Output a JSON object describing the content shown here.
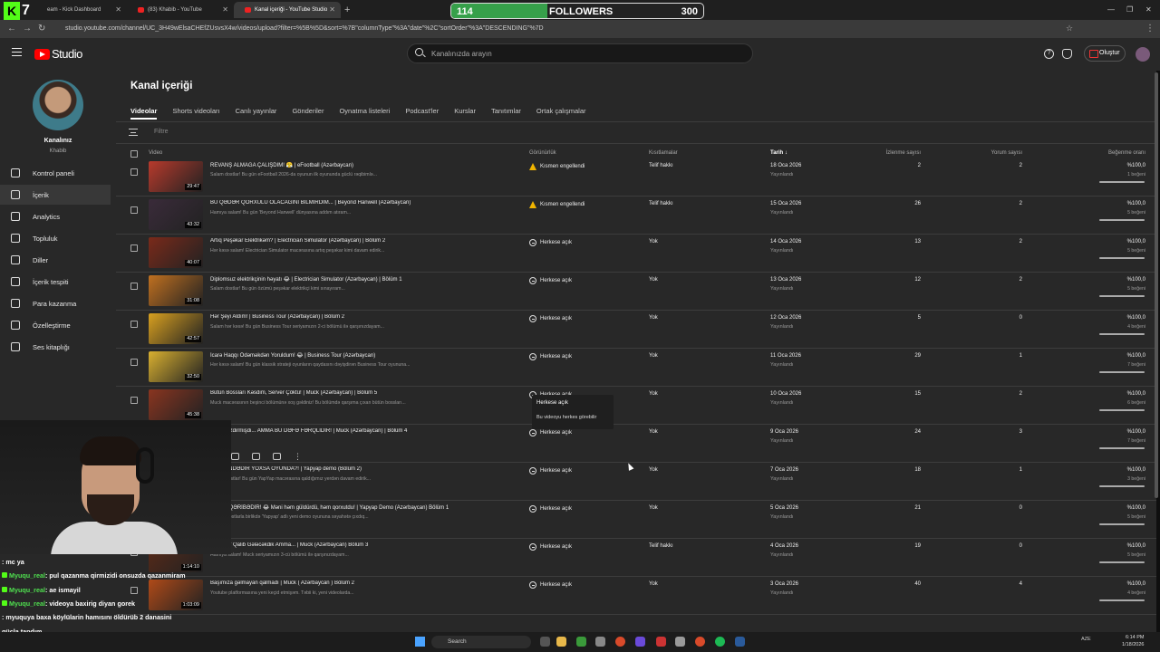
{
  "browser": {
    "tabs": [
      {
        "label": "eam - Kick Dashboard",
        "active": false
      },
      {
        "label": "(83) Khabib - YouTube",
        "active": false
      },
      {
        "label": "Kanal içeriği - YouTube Studio",
        "active": true
      }
    ],
    "url": "studio.youtube.com/channel/UC_3H49wElsaCHEfZUsvsX4w/videos/upload?filter=%5B%5D&sort=%7B\"columnType\"%3A\"date\"%2C\"sortOrder\"%3A\"DESCENDING\"%7D"
  },
  "overlay": {
    "kick_logo_number": "7",
    "followers_label": "FOLLOWERS",
    "followers_current": "114",
    "followers_goal": "300",
    "followers_progress": 0.38
  },
  "header": {
    "logo_text": "Studio",
    "search_placeholder": "Kanalınızda arayın",
    "create_label": "Oluştur"
  },
  "sidebar": {
    "channel_title": "Kanalınız",
    "channel_name": "Khabib",
    "items": [
      {
        "label": "Kontrol paneli",
        "icon": "dashboard-icon",
        "active": false
      },
      {
        "label": "İçerik",
        "icon": "content-icon",
        "active": true
      },
      {
        "label": "Analytics",
        "icon": "analytics-icon",
        "active": false
      },
      {
        "label": "Topluluk",
        "icon": "community-icon",
        "active": false
      },
      {
        "label": "Diller",
        "icon": "languages-icon",
        "active": false
      },
      {
        "label": "İçerik tespiti",
        "icon": "content-detection-icon",
        "active": false
      },
      {
        "label": "Para kazanma",
        "icon": "monetization-icon",
        "active": false
      },
      {
        "label": "Özelleştirme",
        "icon": "customization-icon",
        "active": false
      },
      {
        "label": "Ses kitaplığı",
        "icon": "audio-library-icon",
        "active": false
      }
    ]
  },
  "main": {
    "title": "Kanal içeriği",
    "tabs": [
      "Videolar",
      "Shorts videoları",
      "Canlı yayınlar",
      "Gönderiler",
      "Oynatma listeleri",
      "Podcast'ler",
      "Kurslar",
      "Tanıtımlar",
      "Ortak çalışmalar"
    ],
    "filter_placeholder": "Filtre",
    "columns": {
      "video": "Video",
      "visibility": "Görünürlük",
      "restrictions": "Kısıtlamalar",
      "date": "Tarih",
      "views": "İzlenme sayısı",
      "comments": "Yorum sayısı",
      "likes": "Beğenme oranı"
    },
    "tooltip": {
      "title": "Herkese açık",
      "desc": "Bu videoyu herkes görebilir"
    },
    "rows": [
      {
        "title": "REVANŞ ALMAĞA ÇALIŞDIM! 😤 | eFootball (Azərbaycan)",
        "desc": "Salam dostlar! Bu gün eFootball 2026-da oyunun ilk oyununda güclü rəqibimlə...",
        "duration": "29:47",
        "visibility": "Kısmen engellendi",
        "vis_icon": "warning-icon",
        "restriction": "Telif hakkı",
        "date": "18 Oca 2026",
        "status": "Yayınlandı",
        "views": "2",
        "comments": "2",
        "like_pct": "%100,0",
        "like_count": "1 beğeni",
        "thumb": "#b83a2c"
      },
      {
        "title": "BU QƏDƏR QORXULU OLACAĞINI BİLMİRDİM... | Beyond Hanwell (Azərbaycan)",
        "desc": "Hamıya salam! Bu gün 'Beyond Hanwell' dünyasına addım atıram...",
        "duration": "43:32",
        "visibility": "Kısmen engellendi",
        "vis_icon": "warning-icon",
        "restriction": "Telif hakkı",
        "date": "15 Oca 2026",
        "status": "Yayınlandı",
        "views": "26",
        "comments": "2",
        "like_pct": "%100,0",
        "like_count": "5 beğeni",
        "thumb": "#3a2b3a"
      },
      {
        "title": "Artıq Peşəkar Elektrikəm? | Electrician Simulator (Azərbaycan) | Bölüm 2",
        "desc": "Hər kəsə salam! Electrician Simulator macərasına artıq peşəkar kimi davam edirik...",
        "duration": "40:07",
        "visibility": "Herkese açık",
        "vis_icon": "globe-icon",
        "restriction": "Yok",
        "date": "14 Oca 2026",
        "status": "Yayınlandı",
        "views": "13",
        "comments": "2",
        "like_pct": "%100,0",
        "like_count": "5 beğeni",
        "thumb": "#7a2a1a"
      },
      {
        "title": "Diplomsuz elektrikçinin həyatı 😂 | Electrician Simulator (Azərbaycan) | Bölüm 1",
        "desc": "Salam dostlar! Bu gün özümü peşəkar elektrikçi kimi sınayıram...",
        "duration": "31:08",
        "visibility": "Herkese açık",
        "vis_icon": "globe-icon",
        "restriction": "Yok",
        "date": "13 Oca 2026",
        "status": "Yayınlandı",
        "views": "12",
        "comments": "2",
        "like_pct": "%100,0",
        "like_count": "5 beğeni",
        "thumb": "#c07020"
      },
      {
        "title": "Hər Şeyi Aldım! | Business Tour (Azərbaycan) | Bölüm 2",
        "desc": "Salam hər kəsə! Bu gün Business Tour seriyamızın 2-ci bölümü ilə qarşınızdayam...",
        "duration": "42:57",
        "visibility": "Herkese açık",
        "vis_icon": "globe-icon",
        "restriction": "Yok",
        "date": "12 Oca 2026",
        "status": "Yayınlandı",
        "views": "5",
        "comments": "0",
        "like_pct": "%100,0",
        "like_count": "4 beğeni",
        "thumb": "#d8a020"
      },
      {
        "title": "İcarə Haqqı Ödəməkdən Yoruldum! 😂 | Business Tour (Azərbaycan)",
        "desc": "Hər kəsə salam! Bu gün klassik strateji oyunların qaydasını dəyişdirən Business Tour oyununa...",
        "duration": "32:50",
        "visibility": "Herkese açık",
        "vis_icon": "globe-icon",
        "restriction": "Yok",
        "date": "11 Oca 2026",
        "status": "Yayınlandı",
        "views": "29",
        "comments": "1",
        "like_pct": "%100,0",
        "like_count": "7 beğeni",
        "thumb": "#d9b030"
      },
      {
        "title": "Bütün Bossları Kəsdim, Server Çöktü! | Muck (Azərbaycan) | Bölüm 5",
        "desc": "Muck macərasının beşinci bölümünə xoş gəldiniz! Bu bölümdə qarşıma çıxan bütün bossları...",
        "duration": "45:38",
        "visibility": "Herkese açık",
        "vis_icon": "globe-icon",
        "restriction": "Yok",
        "date": "10 Oca 2026",
        "status": "Yayınlandı",
        "views": "15",
        "comments": "2",
        "like_pct": "%100,0",
        "like_count": "6 beğeni",
        "thumb": "#8a3520"
      },
      {
        "title": "ulani Bezdirmişdi... AMMA BU DƏFƏ FƏRQLİDİR! | Muck (Azərbaycan) | Bölüm 4",
        "desc": "",
        "duration": "",
        "visibility": "Herkese açık",
        "vis_icon": "globe-icon",
        "restriction": "Yok",
        "date": "9 Oca 2026",
        "status": "Yayınlandı",
        "views": "24",
        "comments": "3",
        "like_pct": "%100,0",
        "like_count": "7 beğeni",
        "thumb": "#303030"
      },
      {
        "title": "EM MƏNDƏDİR YOXSA OYUNDA?! | Yapyap demo (Bölüm 2)",
        "desc": "salam, dostlar! Bu gün YapYap macərasına qaldığımız yerdən davam edirik...",
        "duration": "",
        "visibility": "Herkese açık",
        "vis_icon": "globe-icon",
        "restriction": "Yok",
        "date": "7 Oca 2026",
        "status": "Yayınlandı",
        "views": "18",
        "comments": "1",
        "like_pct": "%100,0",
        "like_count": "3 beğeni",
        "thumb": "#303030"
      },
      {
        "title": "N ÇOX QƏRİBƏDİR! 😂 Məni həm güldürdü, həm qorxutdu! | Yapyap Demo (Azərbaycan) Bölüm 1",
        "desc": "Bu gün dostlarla birlikdə 'Yapyap' adlı yeni demo oyununa səyahətə çıxdıq...",
        "duration": "",
        "visibility": "Herkese açık",
        "vis_icon": "globe-icon",
        "restriction": "Yok",
        "date": "5 Oca 2026",
        "status": "Yayınlandı",
        "views": "21",
        "comments": "0",
        "like_pct": "%100,0",
        "like_count": "5 beğeni",
        "thumb": "#303030"
      },
      {
        "title": "Bu Səfər Qalib Gələcəkdik Amma... | Muck (Azərbaycan) Bölüm 3",
        "desc": "Hamıya salam! Muck seriyamızın 3-cü bölümü ilə qarşınızdayam...",
        "duration": "1:14:10",
        "visibility": "Herkese açık",
        "vis_icon": "globe-icon",
        "restriction": "Telif hakkı",
        "date": "4 Oca 2026",
        "status": "Yayınlandı",
        "views": "19",
        "comments": "0",
        "like_pct": "%100,0",
        "like_count": "5 beğeni",
        "thumb": "#5a2a18"
      },
      {
        "title": "Başımıza gəlmayan qalmadı | Muck ( Azərbaycan ) Bölüm 2",
        "desc": "Youtube platformasına yeni keçid etmişəm. Təbii ki, yeni videolarda...",
        "duration": "1:03:09",
        "visibility": "Herkese açık",
        "vis_icon": "globe-icon",
        "restriction": "Yok",
        "date": "3 Oca 2026",
        "status": "Yayınlandı",
        "views": "40",
        "comments": "4",
        "like_pct": "%100,0",
        "like_count": "4 beğeni",
        "thumb": "#b04a18"
      }
    ]
  },
  "chat": [
    {
      "user": "",
      "msg": ": mc ya",
      "color": "r"
    },
    {
      "user": "Myuqu_real",
      "msg": ": pul qazanma qirmizidi onsuzda qazanmiram",
      "color": "g"
    },
    {
      "user": "Myuqu_real",
      "msg": ": ae ismayil",
      "color": "g"
    },
    {
      "user": "Myuqu_real",
      "msg": ": videoya baxirig diyan gorek",
      "color": "g"
    },
    {
      "user": "",
      "msg": ": myuquya baxa köylülarin hamısını öldürüb 2 danasini",
      "color": "p"
    },
    {
      "user": "",
      "msg": "gücla tapdım",
      "color": "p"
    },
    {
      "user": "LavoboAcici",
      "msg": ": mc varmı abi",
      "color": "g"
    }
  ],
  "taskbar": {
    "search_label": "Search",
    "lang": "AZE",
    "time": "6:14 PM",
    "date": "1/18/2026"
  }
}
